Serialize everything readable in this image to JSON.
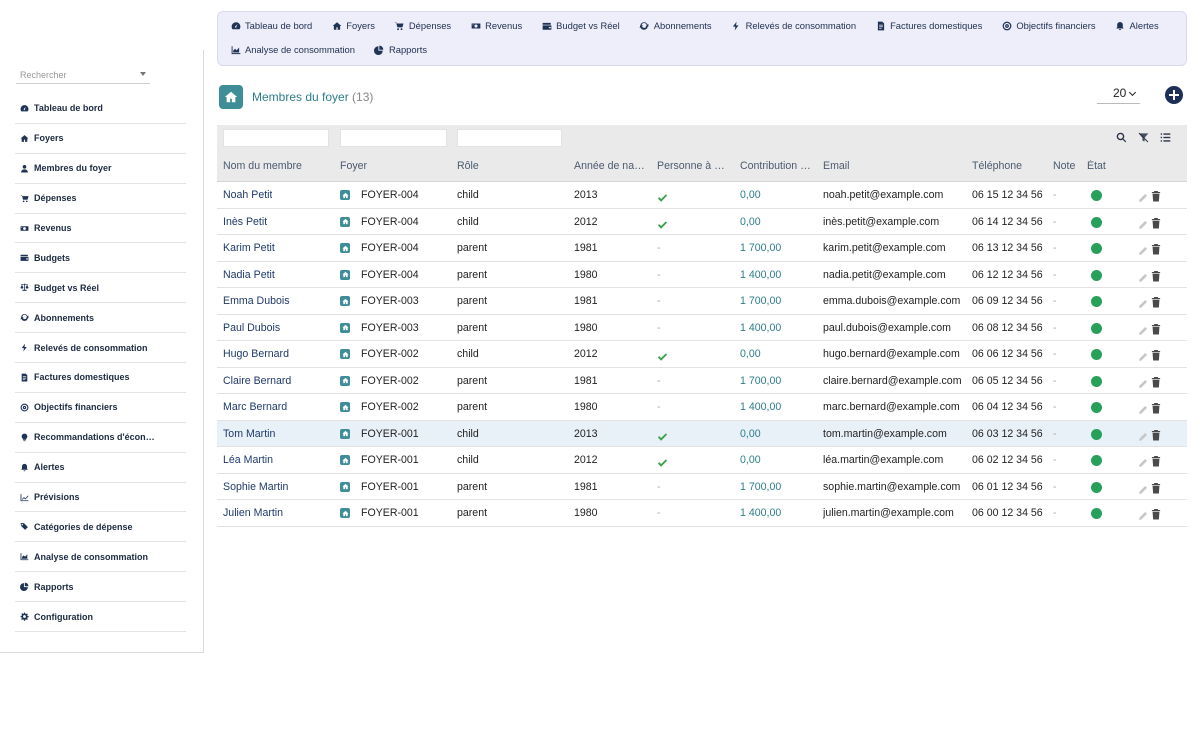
{
  "sidebar": {
    "search_placeholder": "Rechercher",
    "items": [
      {
        "label": "Tableau de bord",
        "icon": "gauge-icon"
      },
      {
        "label": "Foyers",
        "icon": "home-icon"
      },
      {
        "label": "Membres du foyer",
        "icon": "user-icon"
      },
      {
        "label": "Dépenses",
        "icon": "cart-icon"
      },
      {
        "label": "Revenus",
        "icon": "money-icon"
      },
      {
        "label": "Budgets",
        "icon": "wallet-icon"
      },
      {
        "label": "Budget vs Réel",
        "icon": "scale-icon"
      },
      {
        "label": "Abonnements",
        "icon": "sync-icon"
      },
      {
        "label": "Relevés de consommation",
        "icon": "bolt-icon"
      },
      {
        "label": "Factures domestiques",
        "icon": "invoice-icon"
      },
      {
        "label": "Objectifs financiers",
        "icon": "target-icon"
      },
      {
        "label": "Recommandations d'écon…",
        "icon": "lightbulb-icon"
      },
      {
        "label": "Alertes",
        "icon": "bell-icon"
      },
      {
        "label": "Prévisions",
        "icon": "trend-icon"
      },
      {
        "label": "Catégories de dépense",
        "icon": "tags-icon"
      },
      {
        "label": "Analyse de consommation",
        "icon": "area-chart-icon"
      },
      {
        "label": "Rapports",
        "icon": "pie-icon"
      },
      {
        "label": "Configuration",
        "icon": "gear-icon"
      }
    ]
  },
  "topmenu": {
    "row1": [
      {
        "label": "Tableau de bord",
        "icon": "gauge-icon"
      },
      {
        "label": "Foyers",
        "icon": "home-icon"
      },
      {
        "label": "Dépenses",
        "icon": "cart-icon"
      },
      {
        "label": "Revenus",
        "icon": "money-icon"
      },
      {
        "label": "Budget vs Réel",
        "icon": "wallet-icon"
      },
      {
        "label": "Abonnements",
        "icon": "sync-icon"
      },
      {
        "label": "Relevés de consommation",
        "icon": "bolt-icon"
      },
      {
        "label": "Factures domestiques",
        "icon": "invoice-icon"
      },
      {
        "label": "Objectifs financiers",
        "icon": "target-icon"
      },
      {
        "label": "Alertes",
        "icon": "bell-icon"
      }
    ],
    "row2": [
      {
        "label": "Analyse de consommation",
        "icon": "area-chart-icon"
      },
      {
        "label": "Rapports",
        "icon": "pie-icon"
      }
    ]
  },
  "page": {
    "title": "Membres du foyer",
    "count": "(13)",
    "page_size": "20"
  },
  "table": {
    "columns": [
      "Nom du membre",
      "Foyer",
      "Rôle",
      "Année de na…",
      "Personne à …",
      "Contribution …",
      "Email",
      "Téléphone",
      "Note",
      "État"
    ],
    "rows": [
      {
        "name": "Noah Petit",
        "foyer": "FOYER-004",
        "role": "child",
        "year": "2013",
        "dependent": true,
        "contribution": "0,00",
        "email": "noah.petit@example.com",
        "phone": "06 15 12 34 56",
        "note": "-"
      },
      {
        "name": "Inès Petit",
        "foyer": "FOYER-004",
        "role": "child",
        "year": "2012",
        "dependent": true,
        "contribution": "0,00",
        "email": "inès.petit@example.com",
        "phone": "06 14 12 34 56",
        "note": "-"
      },
      {
        "name": "Karim Petit",
        "foyer": "FOYER-004",
        "role": "parent",
        "year": "1981",
        "dependent": false,
        "contribution": "1 700,00",
        "email": "karim.petit@example.com",
        "phone": "06 13 12 34 56",
        "note": "-"
      },
      {
        "name": "Nadia Petit",
        "foyer": "FOYER-004",
        "role": "parent",
        "year": "1980",
        "dependent": false,
        "contribution": "1 400,00",
        "email": "nadia.petit@example.com",
        "phone": "06 12 12 34 56",
        "note": "-"
      },
      {
        "name": "Emma Dubois",
        "foyer": "FOYER-003",
        "role": "parent",
        "year": "1981",
        "dependent": false,
        "contribution": "1 700,00",
        "email": "emma.dubois@example.com",
        "phone": "06 09 12 34 56",
        "note": "-"
      },
      {
        "name": "Paul Dubois",
        "foyer": "FOYER-003",
        "role": "parent",
        "year": "1980",
        "dependent": false,
        "contribution": "1 400,00",
        "email": "paul.dubois@example.com",
        "phone": "06 08 12 34 56",
        "note": "-"
      },
      {
        "name": "Hugo Bernard",
        "foyer": "FOYER-002",
        "role": "child",
        "year": "2012",
        "dependent": true,
        "contribution": "0,00",
        "email": "hugo.bernard@example.com",
        "phone": "06 06 12 34 56",
        "note": "-"
      },
      {
        "name": "Claire Bernard",
        "foyer": "FOYER-002",
        "role": "parent",
        "year": "1981",
        "dependent": false,
        "contribution": "1 700,00",
        "email": "claire.bernard@example.com",
        "phone": "06 05 12 34 56",
        "note": "-"
      },
      {
        "name": "Marc Bernard",
        "foyer": "FOYER-002",
        "role": "parent",
        "year": "1980",
        "dependent": false,
        "contribution": "1 400,00",
        "email": "marc.bernard@example.com",
        "phone": "06 04 12 34 56",
        "note": "-"
      },
      {
        "name": "Tom Martin",
        "foyer": "FOYER-001",
        "role": "child",
        "year": "2013",
        "dependent": true,
        "contribution": "0,00",
        "email": "tom.martin@example.com",
        "phone": "06 03 12 34 56",
        "note": "-",
        "highlighted": true
      },
      {
        "name": "Léa Martin",
        "foyer": "FOYER-001",
        "role": "child",
        "year": "2012",
        "dependent": true,
        "contribution": "0,00",
        "email": "léa.martin@example.com",
        "phone": "06 02 12 34 56",
        "note": "-"
      },
      {
        "name": "Sophie Martin",
        "foyer": "FOYER-001",
        "role": "parent",
        "year": "1981",
        "dependent": false,
        "contribution": "1 700,00",
        "email": "sophie.martin@example.com",
        "phone": "06 01 12 34 56",
        "note": "-"
      },
      {
        "name": "Julien Martin",
        "foyer": "FOYER-001",
        "role": "parent",
        "year": "1980",
        "dependent": false,
        "contribution": "1 400,00",
        "email": "julien.martin@example.com",
        "phone": "06 00 12 34 56",
        "note": "-"
      }
    ],
    "dependent_no_mark": "-"
  },
  "colors": {
    "accent": "#2e7d8b",
    "navy": "#1e2f57",
    "status_active": "#27a05a",
    "check": "#3aa14a",
    "menu_bg": "#eeeefb"
  }
}
